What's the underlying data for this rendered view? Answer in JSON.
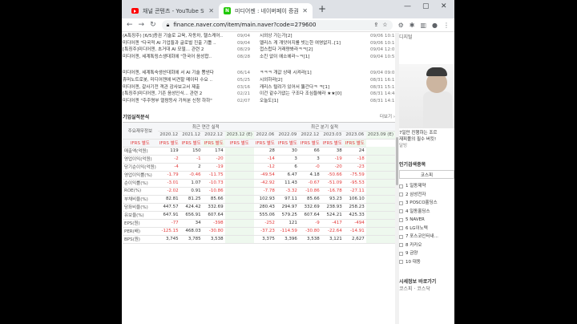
{
  "tabs": [
    {
      "label": "채널 콘텐츠 - YouTube Studio"
    },
    {
      "label": "미디어젠 : 네이버페이 증권"
    }
  ],
  "url": "finance.naver.com/item/main.naver?code=279600",
  "news": [
    {
      "t1": "(A특징주) [6/5]증권 기술로 교육, 자동차, 헬스케어..",
      "d1": "09/04",
      "t2": "시외상 가는가[2]",
      "d2": "09/06 10:16"
    },
    {
      "t1": "미디어젠 \"다국적 AI 기업들과 글로벌 진출 기틀 ..",
      "d1": "09/04",
      "t2": "멜리스 게 개앗어지를 빗는한 여영없지..[1]",
      "d2": "09/06 10:10"
    },
    {
      "t1": "[특징주]미디어젠, 초거대 AI 모델...  관련 2",
      "d1": "08/29",
      "t2": "껍스럽다 거래량봐라ㅋㅋ[2]",
      "d2": "09/04 12:01"
    },
    {
      "t1": "미디어젠, 세계톡링스생대회에 \"한국어 음성합..",
      "d1": "08/28",
      "t2": "소킨 없이 에소헤라~ㅋ[1]",
      "d2": "09/04 10:57"
    },
    {
      "t1": "미디어젠, 세계톡숙생산대회에 서 AI 기술 뽐낸다",
      "d1": "06/14",
      "t2": "ㅋㅋㅋ 개값 상태 시켜라[1]",
      "d2": "09/04 09:05"
    },
    {
      "t1": "휴머노트로봇, 미디어젠에 비견할 메이터 수요 ..",
      "d1": "05/25",
      "t2": "시외하라[2]",
      "d2": "08/31 16:11"
    },
    {
      "t1": "미디어젠, 갈사기전 객관 감사보고서 제출",
      "d1": "03/16",
      "t2": "캐리스 털려가 있어서 뚫간다ㅋ ㅋ[1]",
      "d2": "08/31 15:12"
    },
    {
      "t1": "[특징주]미디어젠, 기존 음성인식...  관련 2",
      "d1": "02/21",
      "t2": "이건 같수가없는 구조다 조심들해라 ★★[0]",
      "d2": "08/31 14:48"
    },
    {
      "t1": "미디어젠 \"주주명부 열람등사 가처분 신청 하하\"",
      "d1": "02/07",
      "t2": "오늘도[1]",
      "d2": "08/31 14:11"
    }
  ],
  "section": {
    "title": "기업실적분석",
    "more": "더보기 ›"
  },
  "table": {
    "head_label": "주요재무정보",
    "group1": "최근 연간 실적",
    "group2": "최근 분기 실적",
    "periods": [
      "2020.12",
      "2021.12",
      "2022.12",
      "2023.12 (E)",
      "2022.06",
      "2022.09",
      "2022.12",
      "2023.03",
      "2023.06",
      "2023.09 (E)"
    ],
    "ifrs": "IFRS 별도",
    "rows": [
      {
        "label": "매출액(억원)",
        "v": [
          "119",
          "150",
          "174",
          "",
          "28",
          "30",
          "66",
          "38",
          "24",
          ""
        ]
      },
      {
        "label": "영업이익(억원)",
        "v": [
          "-2",
          "-1",
          "-20",
          "",
          "-14",
          "3",
          "3",
          "-19",
          "-18",
          ""
        ]
      },
      {
        "label": "당기순이익(억원)",
        "v": [
          "-4",
          "2",
          "-19",
          "",
          "-12",
          "6",
          "-0",
          "-20",
          "-23",
          ""
        ]
      },
      {
        "label": "영업이익률(%)",
        "v": [
          "-1.79",
          "-0.46",
          "-11.75",
          "",
          "-49.54",
          "6.47",
          "4.18",
          "-50.66",
          "-75.59",
          ""
        ]
      },
      {
        "label": "순이익률(%)",
        "v": [
          "-3.01",
          "1.07",
          "-10.73",
          "",
          "-42.92",
          "11.43",
          "-0.67",
          "-51.09",
          "-95.53",
          ""
        ]
      },
      {
        "label": "ROE(%)",
        "v": [
          "-2.02",
          "0.91",
          "-10.86",
          "",
          "-7.78",
          "-3.32",
          "-10.86",
          "-16.78",
          "-27.11",
          ""
        ]
      },
      {
        "label": "부채비율(%)",
        "v": [
          "82.81",
          "81.25",
          "85.66",
          "",
          "102.93",
          "97.11",
          "85.66",
          "93.23",
          "106.10",
          ""
        ]
      },
      {
        "label": "당좌비율(%)",
        "v": [
          "447.57",
          "424.42",
          "332.69",
          "",
          "280.43",
          "294.97",
          "332.69",
          "238.93",
          "258.23",
          ""
        ]
      },
      {
        "label": "유보율(%)",
        "v": [
          "647.91",
          "656.91",
          "607.64",
          "",
          "555.06",
          "579.25",
          "607.64",
          "524.21",
          "425.33",
          ""
        ]
      },
      {
        "label": "EPS(원)",
        "v": [
          "-77",
          "34",
          "-398",
          "",
          "-252",
          "121",
          "-9",
          "-417",
          "-494",
          ""
        ]
      },
      {
        "label": "PER(배)",
        "v": [
          "-125.15",
          "468.03",
          "-30.80",
          "",
          "-37.23",
          "-114.59",
          "-30.80",
          "-22.64",
          "-14.91",
          ""
        ]
      },
      {
        "label": "BPS(원)",
        "v": [
          "3,745",
          "3,785",
          "3,538",
          "",
          "3,375",
          "3,396",
          "3,538",
          "3,121",
          "2,627",
          ""
        ]
      }
    ]
  },
  "side": {
    "top": "디지털",
    "ad1": "7일만 진행하는 조르",
    "ad2": "재피폴의 필수 버킷!",
    "ad3": "달빙",
    "related_title": "인기검색종목",
    "kospi": "코스피",
    "ranks": [
      "1 일동제약",
      "2 삼성전자",
      "3 POSCO홀딩스",
      "4 일동홀딩스",
      "5 NAVER",
      "6 LG이노텍",
      "7 포스코인터내...",
      "8 카카오",
      "9 금양",
      "10 대동"
    ],
    "bottom": "시세정보 바로가기",
    "bottom2": "코스피 · 코스닥"
  }
}
